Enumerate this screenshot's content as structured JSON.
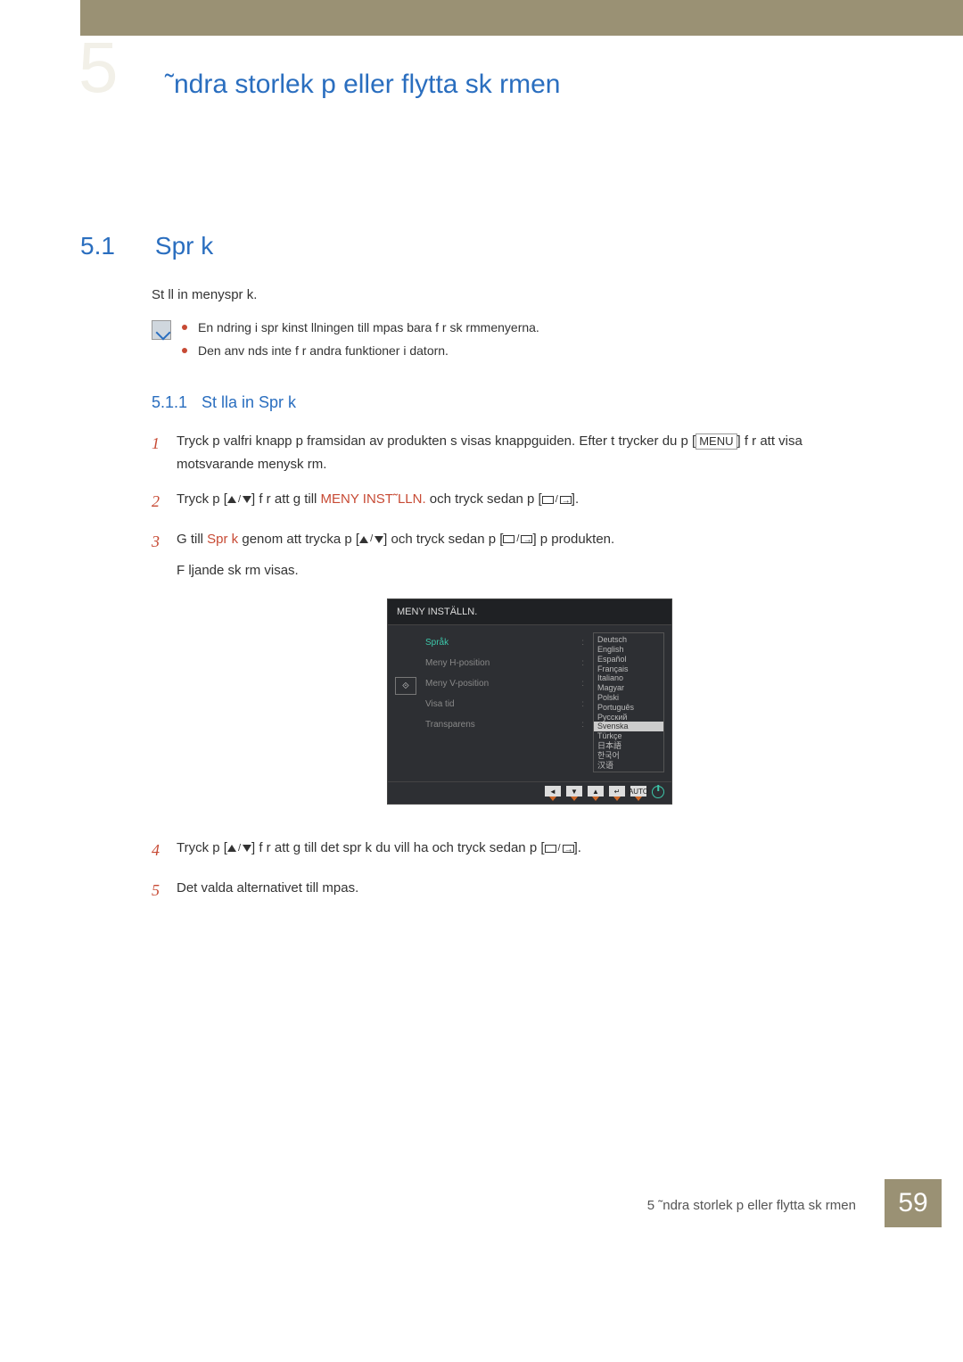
{
  "header": {
    "chapter_num": "5",
    "chapter_title": "˜ndra storlek p  eller flytta sk rmen"
  },
  "section": {
    "num": "5.1",
    "name": "Spr k",
    "intro": "St ll in menyspr k.",
    "notes": [
      "En  ndring i spr kinst llningen till mpas bara f r sk rmmenyerna.",
      "Den anv nds inte f r andra funktioner i datorn."
    ]
  },
  "subsection": {
    "num": "5.1.1",
    "name": "St lla in Spr k"
  },
  "steps": {
    "s1_a": "Tryck p  valfri knapp p  framsidan av produkten s  visas knappguiden. Efter t trycker du p  [",
    "s1_menu": "MENU",
    "s1_b": "] f r att visa motsvarande menysk rm.",
    "s2_a": "Tryck p  [",
    "s2_b": "] f r att g  till ",
    "s2_red": "MENY INST˜LLN.",
    "s2_c": " och tryck sedan p  [",
    "s2_d": "].",
    "s3_a": "G  till ",
    "s3_red": "Spr k",
    "s3_b": " genom att trycka p  [",
    "s3_c": "] och tryck sedan p  [",
    "s3_d": "] p  produkten.",
    "s3_follow": "F ljande sk rm visas.",
    "s4_a": "Tryck p  [",
    "s4_b": "] f r att g  till det spr k du vill ha och tryck sedan p  [",
    "s4_c": "].",
    "s5": "Det valda alternativet till mpas."
  },
  "osd": {
    "title": "MENY INSTÄLLN.",
    "items": [
      "Språk",
      "Meny H-position",
      "Meny V-position",
      "Visa tid",
      "Transparens"
    ],
    "languages": [
      "Deutsch",
      "English",
      "Español",
      "Français",
      "Italiano",
      "Magyar",
      "Polski",
      "Português",
      "Русский",
      "Svenska",
      "Türkçe",
      "日本語",
      "한국어",
      "汉语"
    ],
    "selected_language_index": 9,
    "footer_auto": "AUTO"
  },
  "footer": {
    "text": "5 ˜ndra storlek p  eller flytta sk rmen",
    "page": "59"
  }
}
